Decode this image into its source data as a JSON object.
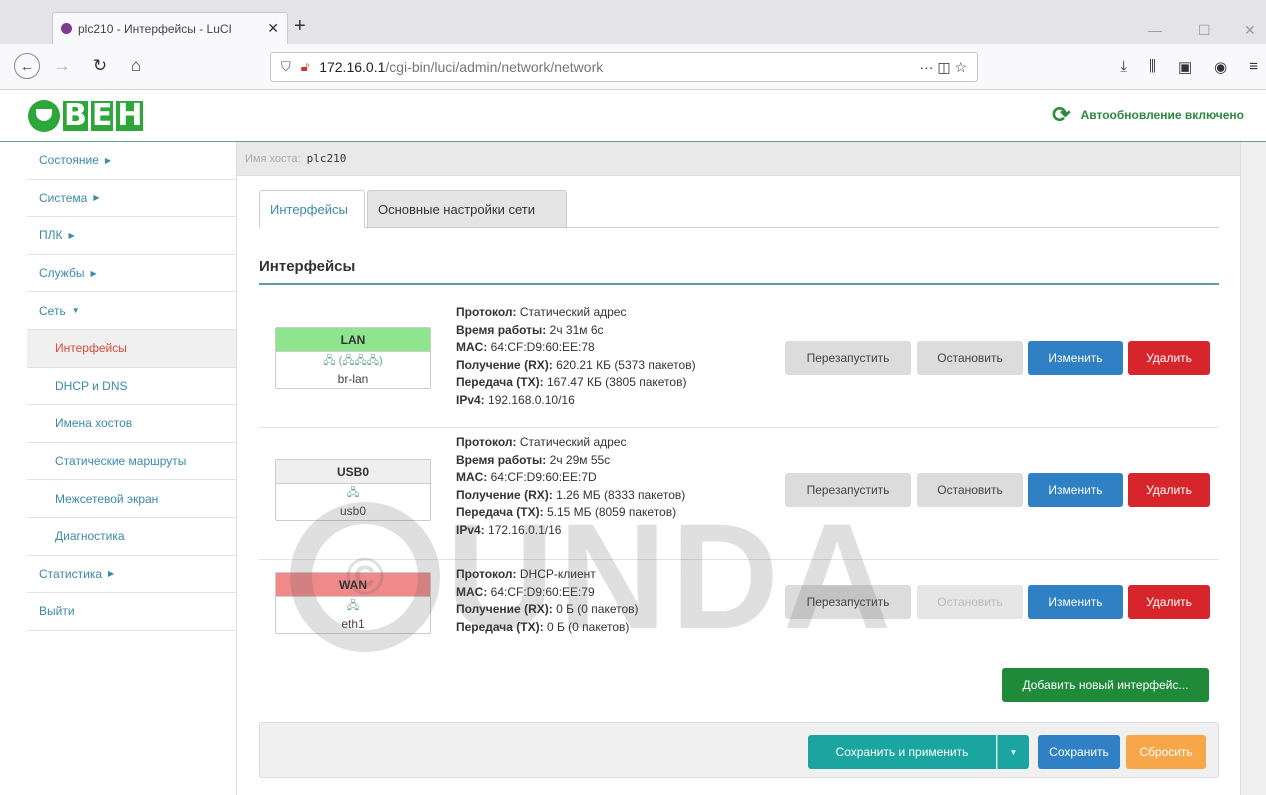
{
  "browser": {
    "tab_title": "plc210 - Интерфейсы - LuCI",
    "tab_close": "✕",
    "new_tab": "+",
    "url_host": "172.16.0.1",
    "url_path": "/cgi-bin/luci/admin/network/network",
    "url_actions": "··· ◫ ☆",
    "win_minimize": "—",
    "win_maximize": "☐",
    "win_close": "✕"
  },
  "header": {
    "logo_letters": [
      "В",
      "Е",
      "Н"
    ],
    "autorefresh": "Автообновление включено"
  },
  "sidebar": {
    "items": [
      {
        "label": "Состояние",
        "caret": "▶"
      },
      {
        "label": "Система",
        "caret": "▶"
      },
      {
        "label": "ПЛК",
        "caret": "▶"
      },
      {
        "label": "Службы",
        "caret": "▶"
      },
      {
        "label": "Сеть",
        "caret": "▼"
      },
      {
        "label": "Интерфейсы"
      },
      {
        "label": "DHCP и DNS"
      },
      {
        "label": "Имена хостов"
      },
      {
        "label": "Статические маршруты"
      },
      {
        "label": "Межсетевой экран"
      },
      {
        "label": "Диагностика"
      },
      {
        "label": "Статистика",
        "caret": "▶"
      },
      {
        "label": "Выйти"
      }
    ]
  },
  "host": {
    "label": "Имя хоста:",
    "value": "plc210"
  },
  "tabs": [
    "Интерфейсы",
    "Основные настройки сети"
  ],
  "section_title": "Интерфейсы",
  "interfaces": [
    {
      "name": "LAN",
      "name_bg": "#8ee58e",
      "icons": "🖧 (🖧🖧🖧)",
      "device": "br-lan",
      "protocol_label": "Протокол:",
      "protocol": "Статический адрес",
      "uptime_label": "Время работы:",
      "uptime": "2ч 31м 6с",
      "mac_label": "MAC:",
      "mac": "64:CF:D9:60:EE:78",
      "rx_label": "Получение (RX):",
      "rx": "620.21 КБ (5373 пакетов)",
      "tx_label": "Передача (TX):",
      "tx": "167.47 КБ (3805 пакетов)",
      "ipv4_label": "IPv4:",
      "ipv4": "192.168.0.10/16"
    },
    {
      "name": "USB0",
      "name_bg": "#efefef",
      "icons": "🖧",
      "device": "usb0",
      "protocol_label": "Протокол:",
      "protocol": "Статический адрес",
      "uptime_label": "Время работы:",
      "uptime": "2ч 29м 55с",
      "mac_label": "MAC:",
      "mac": "64:CF:D9:60:EE:7D",
      "rx_label": "Получение (RX):",
      "rx": "1.26 МБ (8333 пакетов)",
      "tx_label": "Передача (TX):",
      "tx": "5.15 МБ (8059 пакетов)",
      "ipv4_label": "IPv4:",
      "ipv4": "172.16.0.1/16"
    },
    {
      "name": "WAN",
      "name_bg": "#f08a8a",
      "icons": "🖧",
      "device": "eth1",
      "protocol_label": "Протокол:",
      "protocol": "DHCP-клиент",
      "mac_label": "MAC:",
      "mac": "64:CF:D9:60:EE:79",
      "rx_label": "Получение (RX):",
      "rx": "0 Б (0 пакетов)",
      "tx_label": "Передача (TX):",
      "tx": "0 Б (0 пакетов)"
    }
  ],
  "row_buttons": {
    "restart": "Перезапустить",
    "stop": "Остановить",
    "edit": "Изменить",
    "delete": "Удалить"
  },
  "add_button": "Добавить новый интерфейс...",
  "footer": {
    "apply": "Сохранить и применить",
    "dropdown": "▼",
    "save": "Сохранить",
    "reset": "Сбросить"
  }
}
